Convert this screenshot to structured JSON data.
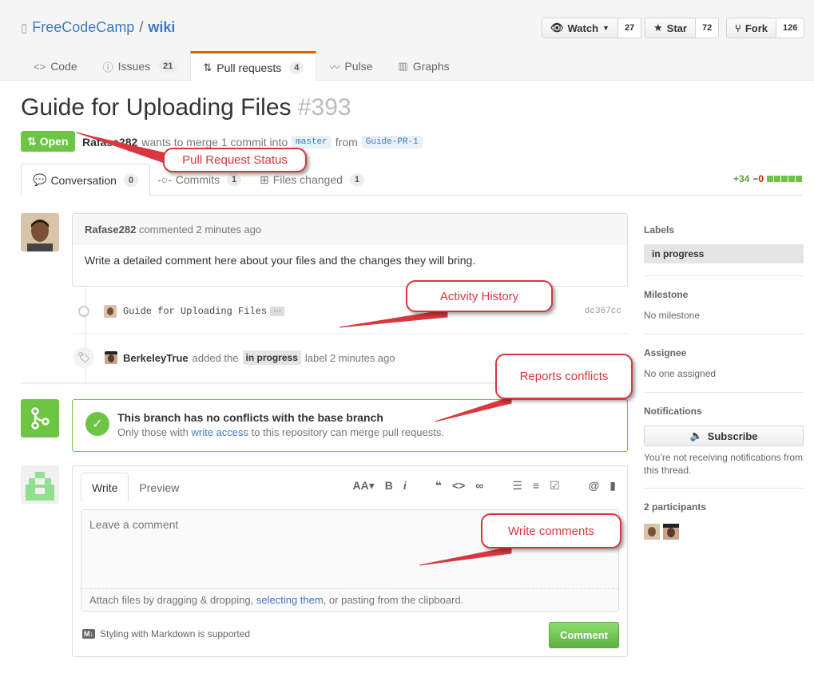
{
  "repo": {
    "owner": "FreeCodeCamp",
    "separator": "/",
    "name": "wiki"
  },
  "actions": {
    "watch_label": "Watch",
    "watch_count": "27",
    "star_label": "Star",
    "star_count": "72",
    "fork_label": "Fork",
    "fork_count": "126"
  },
  "reponav": {
    "code": "Code",
    "issues": "Issues",
    "issues_count": "21",
    "pulls": "Pull requests",
    "pulls_count": "4",
    "pulse": "Pulse",
    "graphs": "Graphs"
  },
  "pr": {
    "title": "Guide for Uploading Files",
    "number": "#393",
    "state": "Open",
    "author": "Rafase282",
    "meta_text": "wants to merge 1 commit into",
    "base_branch": "master",
    "from_text": "from",
    "head_branch": "Guide-PR-1"
  },
  "tabs": {
    "conversation": "Conversation",
    "conversation_count": "0",
    "commits": "Commits",
    "commits_count": "1",
    "files": "Files changed",
    "files_count": "1",
    "additions": "+34",
    "deletions": "−0"
  },
  "comment": {
    "author": "Rafase282",
    "action": "commented 2 minutes ago",
    "body": "Write a detailed comment here about your files and the changes they will bring."
  },
  "commit": {
    "message": "Guide for Uploading Files",
    "ellipsis": "···",
    "sha": "dc367cc"
  },
  "label_event": {
    "actor": "BerkeleyTrue",
    "prefix": "added the",
    "label": "in progress",
    "suffix": "label 2 minutes ago"
  },
  "merge": {
    "title": "This branch has no conflicts with the base branch",
    "sub_prefix": "Only those with",
    "sub_link": "write access",
    "sub_suffix": "to this repository can merge pull requests."
  },
  "composer": {
    "write_tab": "Write",
    "preview_tab": "Preview",
    "placeholder": "Leave a comment",
    "attach_prefix": "Attach files by dragging & dropping,",
    "attach_link": "selecting them",
    "attach_suffix": ", or pasting from the clipboard.",
    "markdown_icon": "M↓",
    "markdown_note": "Styling with Markdown is supported",
    "submit": "Comment"
  },
  "sidebar": {
    "labels_h": "Labels",
    "label_value": "in progress",
    "milestone_h": "Milestone",
    "milestone_v": "No milestone",
    "assignee_h": "Assignee",
    "assignee_v": "No one assigned",
    "notifications_h": "Notifications",
    "subscribe": "Subscribe",
    "notif_note": "You’re not receiving notifications from this thread.",
    "participants_h": "2 participants"
  },
  "annotations": {
    "status": "Pull Request Status",
    "activity": "Activity History",
    "conflicts": "Reports conflicts",
    "write": "Write comments"
  },
  "colors": {
    "accent_green": "#6cc644",
    "link_blue": "#4078c0",
    "annotation_red": "#d9363e",
    "tab_orange": "#d26911"
  }
}
